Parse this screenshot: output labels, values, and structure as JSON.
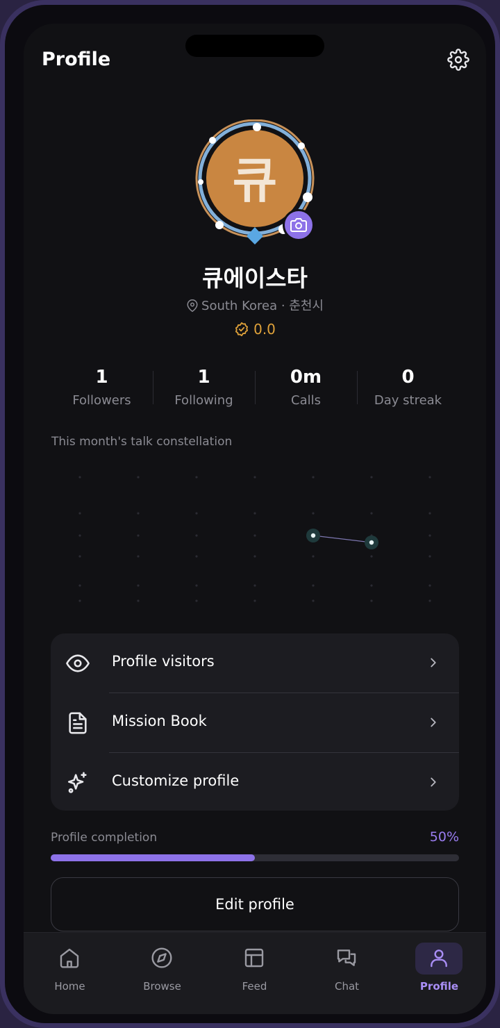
{
  "header": {
    "title": "Profile"
  },
  "profile": {
    "avatar_text": "큐",
    "name": "큐에이스타",
    "location": "South Korea · 춘천시",
    "rating": "0.0"
  },
  "stats": [
    {
      "value": "1",
      "label": "Followers"
    },
    {
      "value": "1",
      "label": "Following"
    },
    {
      "value": "0m",
      "label": "Calls"
    },
    {
      "value": "0",
      "label": "Day streak"
    }
  ],
  "constellation": {
    "label": "This month's talk constellation"
  },
  "menu": [
    {
      "label": "Profile visitors",
      "icon": "eye-icon"
    },
    {
      "label": "Mission Book",
      "icon": "document-icon"
    },
    {
      "label": "Customize profile",
      "icon": "sparkles-icon"
    }
  ],
  "completion": {
    "label": "Profile completion",
    "value_text": "50%",
    "fraction": 0.5
  },
  "edit_button": {
    "label": "Edit profile"
  },
  "nav": [
    {
      "label": "Home",
      "icon": "home-icon"
    },
    {
      "label": "Browse",
      "icon": "compass-icon"
    },
    {
      "label": "Feed",
      "icon": "layout-icon"
    },
    {
      "label": "Chat",
      "icon": "chat-icon"
    },
    {
      "label": "Profile",
      "icon": "user-icon",
      "active": true
    }
  ],
  "colors": {
    "accent": "#8d72e8",
    "avatar": "#c98641",
    "rating": "#e0a23a",
    "background": "#111114"
  }
}
